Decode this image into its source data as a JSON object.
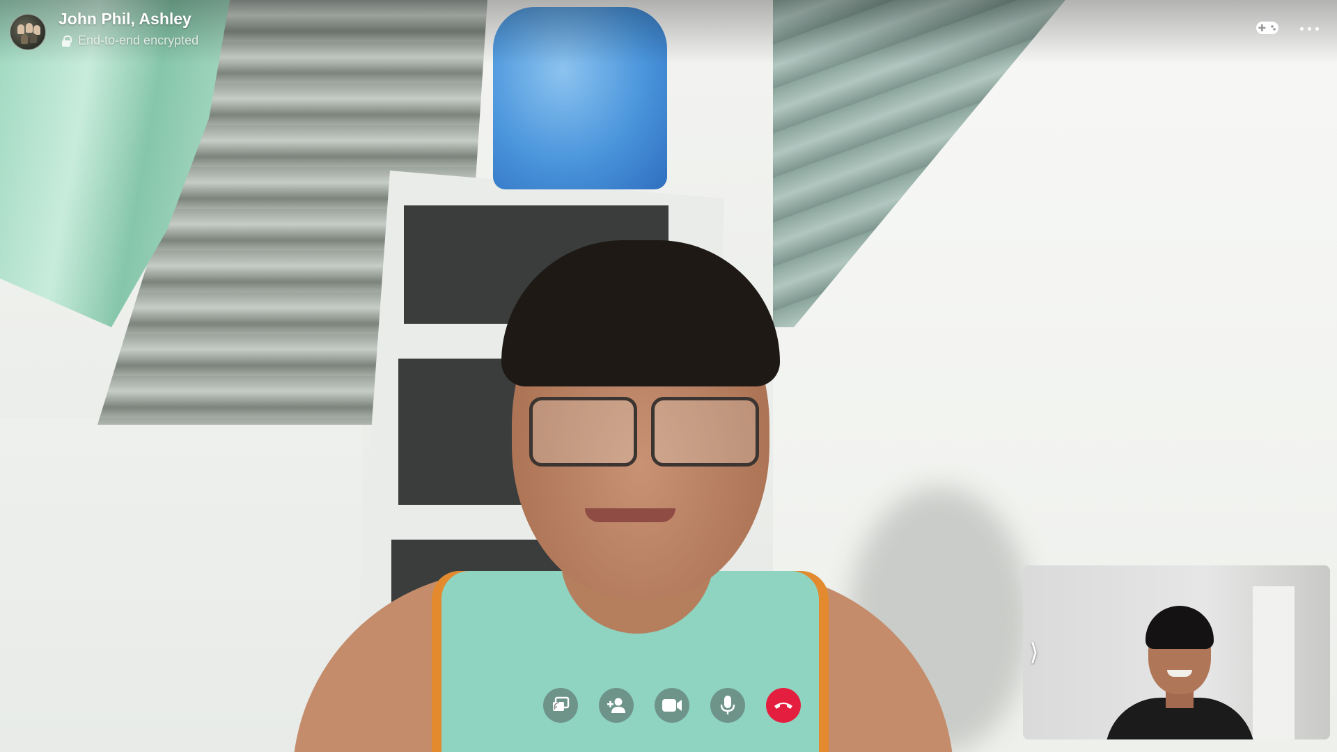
{
  "call": {
    "participants_title": "John Phil, Ashley",
    "encryption_status": "End-to-end encrypted"
  },
  "icons": {
    "lock": "lock-icon",
    "game": "game-controller-icon",
    "more": "more-options-icon",
    "collapse": "chevron-right-icon"
  },
  "controls": [
    {
      "name": "share-screen-button",
      "icon": "screen-share-icon"
    },
    {
      "name": "add-people-button",
      "icon": "add-person-icon"
    },
    {
      "name": "camera-toggle-button",
      "icon": "video-camera-icon"
    },
    {
      "name": "mic-toggle-button",
      "icon": "microphone-icon"
    },
    {
      "name": "end-call-button",
      "icon": "hang-up-icon"
    }
  ],
  "colors": {
    "end_call": "#e41e3f",
    "control_bg": "rgba(70,70,70,.45)"
  }
}
